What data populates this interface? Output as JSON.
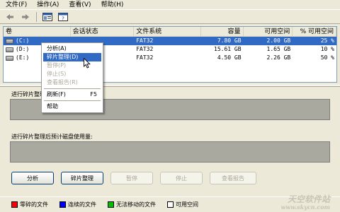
{
  "menubar": {
    "items": [
      "文件(F)",
      "操作(A)",
      "查看(V)",
      "帮助(H)"
    ]
  },
  "toolbar": {
    "buttons": [
      "back-icon",
      "forward-icon",
      "properties-icon",
      "help-icon"
    ]
  },
  "volumes": {
    "headers": [
      "卷",
      "会话状态",
      "文件系统",
      "容量",
      "可用空间",
      "% 可用空间"
    ],
    "rows": [
      {
        "volume": "(C:)",
        "state": "",
        "fs": "FAT32",
        "capacity": "7.80 GB",
        "free": "2.00 GB",
        "pct": "25 %",
        "selected": true
      },
      {
        "volume": "(D:)",
        "state": "",
        "fs": "FAT32",
        "capacity": "15.61 GB",
        "free": "1.65 GB",
        "pct": "10 %",
        "selected": false
      },
      {
        "volume": "(E:)",
        "state": "",
        "fs": "FAT32",
        "capacity": "4.50 GB",
        "free": "2.26 GB",
        "pct": "50 %",
        "selected": false
      }
    ]
  },
  "context_menu": {
    "items": [
      {
        "label": "分析(A)",
        "shortcut": "",
        "state": "normal"
      },
      {
        "label": "碎片整理(D)",
        "shortcut": "",
        "state": "highlighted"
      },
      {
        "label": "暂停(P)",
        "shortcut": "",
        "state": "disabled"
      },
      {
        "label": "停止(S)",
        "shortcut": "",
        "state": "disabled"
      },
      {
        "label": "查看报告(R)",
        "shortcut": "",
        "state": "disabled"
      },
      {
        "label": "刷新(F)",
        "shortcut": "F5",
        "state": "normal"
      },
      {
        "label": "帮助",
        "shortcut": "",
        "state": "normal"
      }
    ]
  },
  "sections": {
    "before_label": "进行碎片整理前预计磁盘使用量:",
    "after_label": "进行碎片整理后预计磁盘使用量:"
  },
  "buttons": {
    "analyze": "分析",
    "defragment": "碎片整理",
    "pause": "暂停",
    "stop": "停止",
    "report": "查看报告"
  },
  "legend": {
    "items": [
      {
        "label": "零碎的文件",
        "color": "#ff0000"
      },
      {
        "label": "连续的文件",
        "color": "#0000ff"
      },
      {
        "label": "无法移动的文件",
        "color": "#00c000"
      },
      {
        "label": "可用空间",
        "color": "#ffffff"
      }
    ]
  },
  "watermark": {
    "line1": "天空软件站",
    "line2": "www.skycn.com"
  },
  "colors": {
    "selection": "#316ac5",
    "graph_bg": "#a9a9a0",
    "window_bg": "#ece9d8"
  }
}
